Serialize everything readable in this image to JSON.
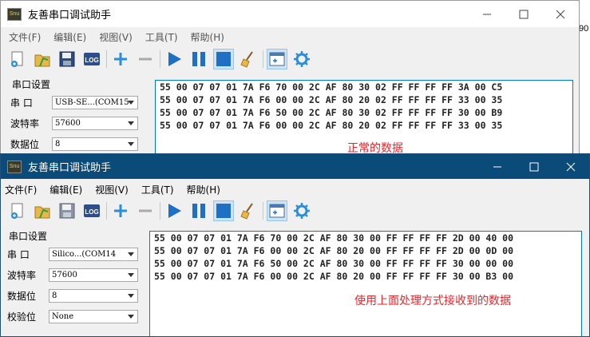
{
  "background_fragment": "90",
  "back_window": {
    "title": "友善串口调试助手",
    "app_icon_text": "Snu",
    "menus": [
      "文件(F)",
      "编辑(E)",
      "视图(V)",
      "工具(T)",
      "帮助(H)"
    ],
    "settings_title": "串口设置",
    "fields": [
      {
        "label": "串 口",
        "value": "USB-SE...(COM15"
      },
      {
        "label": "波特率",
        "value": "57600"
      },
      {
        "label": "数据位",
        "value": "8"
      }
    ],
    "received_lines": [
      "55 00 07 07 01 7A F6 70 00 2C AF 80 30 02 FF FF FF FF 3A 00 C5",
      "55 00 07 07 01 7A F6 00 00 2C AF 80 20 02 FF FF FF FF 33 00 35",
      "55 00 07 07 01 7A F6 50 00 2C AF 80 30 02 FF FF FF FF 30 00 B9",
      "55 00 07 07 01 7A F6 00 00 2C AF 80 20 02 FF FF FF FF 33 00 35"
    ],
    "annotation": "正常的数据"
  },
  "front_window": {
    "title": "友善串口调试助手",
    "app_icon_text": "Snu",
    "menus": [
      "文件(F)",
      "编辑(E)",
      "视图(V)",
      "工具(T)",
      "帮助(H)"
    ],
    "settings_title": "串口设置",
    "fields": [
      {
        "label": "串 口",
        "value": "Silico...(COM14"
      },
      {
        "label": "波特率",
        "value": "57600"
      },
      {
        "label": "数据位",
        "value": "8"
      },
      {
        "label": "校验位",
        "value": "None"
      }
    ],
    "received_lines": [
      "55 00 07 07 01 7A F6 70 00 2C AF 80 30 00 FF FF FF FF 2D 00 40 00",
      "55 00 07 07 01 7A F6 00 00 2C AF 80 20 00 FF FF FF FF 2D 00 0D 00",
      "55 00 07 07 01 7A F6 50 00 2C AF 80 30 00 FF FF FF FF 30 00 00 00",
      "55 00 07 07 01 7A F6 00 00 2C AF 80 20 00 FF FF FF FF 30 00 B3 00"
    ],
    "annotation": "使用上面处理方式接收到的数据"
  },
  "colors": {
    "front_titlebar": "#0b4b7a",
    "annotation": "#e8262c",
    "selected_tool": "#cce4f7",
    "recv_border": "#0078d7"
  }
}
